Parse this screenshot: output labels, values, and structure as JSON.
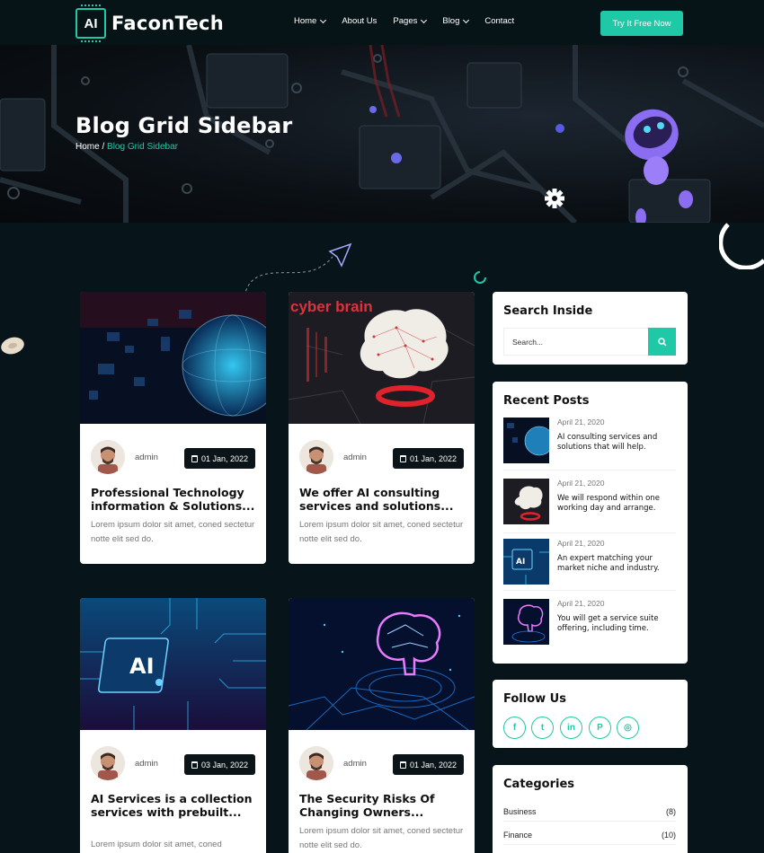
{
  "brand": {
    "logo_mark": "AI",
    "name": "FaconTech"
  },
  "nav": {
    "items": [
      {
        "label": "Home",
        "dropdown": true
      },
      {
        "label": "About Us",
        "dropdown": false
      },
      {
        "label": "Pages",
        "dropdown": true
      },
      {
        "label": "Blog",
        "dropdown": true
      },
      {
        "label": "Contact",
        "dropdown": false
      }
    ],
    "cta": "Try It Free Now"
  },
  "hero": {
    "title": "Blog Grid Sidebar",
    "breadcrumb_home": "Home",
    "breadcrumb_sep": " / ",
    "breadcrumb_current": "Blog Grid Sidebar"
  },
  "posts": [
    {
      "author": "admin",
      "date": "01 Jan, 2022",
      "title": "Professional Technology information & Solutions...",
      "excerpt": "Lorem ipsum dolor sit amet, coned sectetur notte elit sed do."
    },
    {
      "author": "admin",
      "date": "01 Jan, 2022",
      "title": "We offer AI consulting services and solutions...",
      "excerpt": "Lorem ipsum dolor sit amet, coned sectetur notte elit sed do.",
      "image_text": "cyber brain"
    },
    {
      "author": "admin",
      "date": "03 Jan, 2022",
      "title": "AI Services is a collection services with prebuilt...",
      "excerpt": "Lorem ipsum dolor sit amet, coned",
      "image_text": "AI"
    },
    {
      "author": "admin",
      "date": "01 Jan, 2022",
      "title": "The Security Risks Of Changing Owners...",
      "excerpt": "Lorem ipsum dolor sit amet, coned sectetur notte elit sed do."
    }
  ],
  "sidebar": {
    "search": {
      "title": "Search Inside",
      "placeholder": "Search..."
    },
    "recent": {
      "title": "Recent Posts",
      "items": [
        {
          "date": "April 21, 2020",
          "title": "AI consulting services and solutions that will help."
        },
        {
          "date": "April 21, 2020",
          "title": "We will respond within one working day and arrange."
        },
        {
          "date": "April 21, 2020",
          "title": "An expert matching your market niche and industry."
        },
        {
          "date": "April 21, 2020",
          "title": "You will get a service suite offering, including time."
        }
      ]
    },
    "follow": {
      "title": "Follow Us",
      "icons": [
        {
          "name": "facebook-icon",
          "glyph": "f"
        },
        {
          "name": "twitter-icon",
          "glyph": "t"
        },
        {
          "name": "linkedin-icon",
          "glyph": "in"
        },
        {
          "name": "pinterest-icon",
          "glyph": "P"
        },
        {
          "name": "instagram-icon",
          "glyph": "◎"
        }
      ]
    },
    "categories": {
      "title": "Categories",
      "items": [
        {
          "name": "Business",
          "count": "(8)"
        },
        {
          "name": "Finance",
          "count": "(10)"
        }
      ]
    }
  },
  "colors": {
    "accent": "#1fc8a6",
    "background": "#07151b",
    "card": "#ffffff",
    "date_badge": "#0b1419"
  }
}
